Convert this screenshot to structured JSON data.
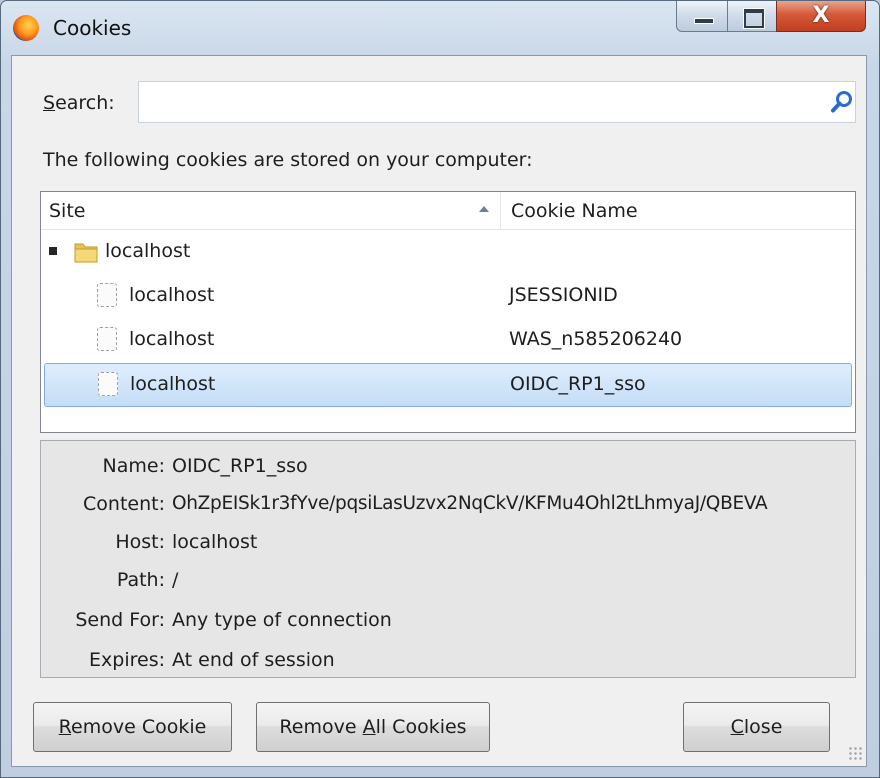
{
  "window": {
    "title": "Cookies",
    "close_glyph": "X"
  },
  "search": {
    "label_accel": "S",
    "label_rest": "earch:",
    "value": "",
    "placeholder": ""
  },
  "description": "The following cookies are stored on your computer:",
  "tree": {
    "columns": [
      "Site",
      "Cookie Name"
    ],
    "sort_column": "Site",
    "sort_direction": "ascending",
    "group": {
      "label": "localhost",
      "expanded": true
    },
    "rows": [
      {
        "site": "localhost",
        "cookie": "JSESSIONID",
        "selected": false
      },
      {
        "site": "localhost",
        "cookie": "WAS_n585206240",
        "selected": false
      },
      {
        "site": "localhost",
        "cookie": "OIDC_RP1_sso",
        "selected": true
      }
    ]
  },
  "details": {
    "fields": [
      {
        "label": "Name:",
        "value": "OIDC_RP1_sso"
      },
      {
        "label": "Content:",
        "value": "OhZpEISk1r3fYve/pqsiLasUzvx2NqCkV/KFMu4Ohl2tLhmyaJ/QBEVA"
      },
      {
        "label": "Host:",
        "value": "localhost"
      },
      {
        "label": "Path:",
        "value": "/"
      },
      {
        "label": "Send For:",
        "value": "Any type of connection"
      },
      {
        "label": "Expires:",
        "value": "At end of session"
      }
    ]
  },
  "buttons": {
    "remove": {
      "accel": "R",
      "rest": "emove Cookie"
    },
    "remove_all": {
      "pre": "Remove ",
      "accel": "A",
      "rest": "ll Cookies"
    },
    "close": {
      "accel": "C",
      "rest": "lose"
    }
  },
  "icons": {
    "app": "firefox-icon",
    "search": "search-icon",
    "folder": "folder-icon",
    "cookie": "cookie-icon"
  },
  "colors": {
    "selection": "#c4ddf6",
    "selection_border": "#84acdd",
    "close_button": "#c13f20",
    "search_icon": "#2a6bd1"
  }
}
